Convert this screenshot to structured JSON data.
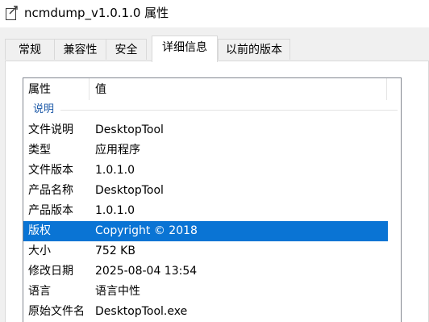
{
  "window": {
    "title": "ncmdump_v1.0.1.0 属性",
    "title_icon": "properties-icon"
  },
  "tabs": [
    {
      "label": "常规",
      "active": false
    },
    {
      "label": "兼容性",
      "active": false
    },
    {
      "label": "安全",
      "active": false
    },
    {
      "label": "详细信息",
      "active": true
    },
    {
      "label": "以前的版本",
      "active": false
    }
  ],
  "details": {
    "columns": {
      "property": "属性",
      "value": "值"
    },
    "group": "说明",
    "rows": [
      {
        "property": "文件说明",
        "value": "DesktopTool"
      },
      {
        "property": "类型",
        "value": "应用程序"
      },
      {
        "property": "文件版本",
        "value": "1.0.1.0"
      },
      {
        "property": "产品名称",
        "value": "DesktopTool"
      },
      {
        "property": "产品版本",
        "value": "1.0.1.0"
      },
      {
        "property": "版权",
        "value": "Copyright ©  2018"
      },
      {
        "property": "大小",
        "value": "752 KB"
      },
      {
        "property": "修改日期",
        "value": "2025-08-04 13:54"
      },
      {
        "property": "语言",
        "value": "语言中性"
      },
      {
        "property": "原始文件名",
        "value": "DesktopTool.exe"
      }
    ],
    "selected_row": 5
  },
  "colors": {
    "selection": "#0a74d4",
    "group_text": "#1e5aa8"
  }
}
